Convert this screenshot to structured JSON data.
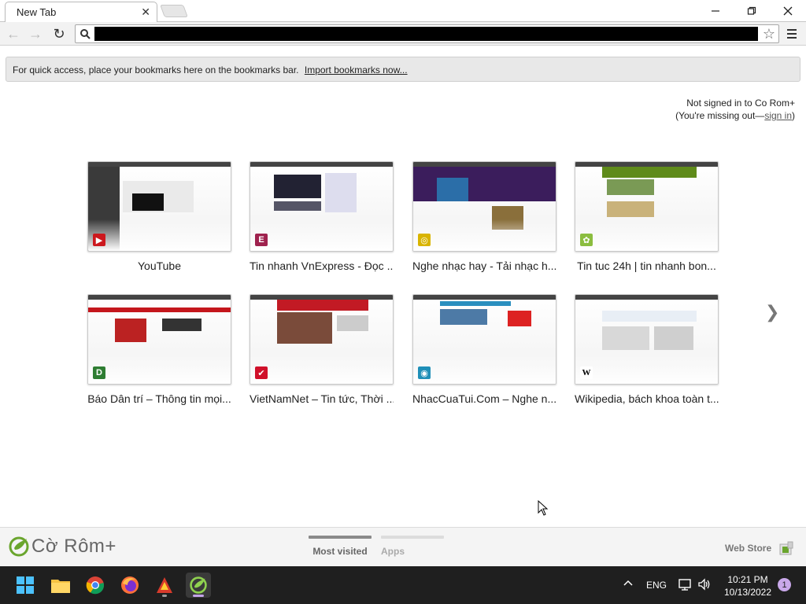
{
  "browser": {
    "tab_title": "New Tab",
    "tab_close": "✕",
    "window_min": "—",
    "window_max": "❐",
    "window_close": "✕",
    "nav_back": "←",
    "nav_forward": "→",
    "nav_reload": "↻",
    "star": "☆"
  },
  "bookmarks_bar": {
    "message": "For quick access, place your bookmarks here on the bookmarks bar.",
    "import_link": "Import bookmarks now..."
  },
  "signin": {
    "line1": "Not signed in to Co Rom+",
    "line2_prefix": "(You're missing out—",
    "link": "sign in",
    "line2_suffix": ")"
  },
  "most_visited": [
    {
      "label": "YouTube",
      "favicon": "youtube-icon",
      "favicon_color": "#cc181e",
      "favicon_glyph": "▶"
    },
    {
      "label": "Tin nhanh VnExpress - Đọc ...",
      "favicon": "vnexpress-icon",
      "favicon_color": "#9f224e",
      "favicon_glyph": "E"
    },
    {
      "label": "Nghe nhạc hay - Tải nhạc h...",
      "favicon": "music-disc-icon",
      "favicon_color": "#d9b400",
      "favicon_glyph": "◎"
    },
    {
      "label": "Tin tuc 24h | tin nhanh bon...",
      "favicon": "24h-icon",
      "favicon_color": "#8bbd3f",
      "favicon_glyph": "✿"
    },
    {
      "label": "Báo Dân trí – Thông tin mọi...",
      "favicon": "dantri-icon",
      "favicon_color": "#2e7d32",
      "favicon_glyph": "D"
    },
    {
      "label": "VietNamNet – Tin tức, Thời ...",
      "favicon": "vietnamnet-icon",
      "favicon_color": "#d0102a",
      "favicon_glyph": "✔"
    },
    {
      "label": "NhacCuaTui.Com – Nghe n...",
      "favicon": "nhaccuatui-icon",
      "favicon_color": "#1f8fb8",
      "favicon_glyph": "◉"
    },
    {
      "label": "Wikipedia, bách khoa toàn t...",
      "favicon": "wikipedia-icon",
      "favicon_color": "#ffffff",
      "favicon_glyph": "W"
    }
  ],
  "next_page": "❯",
  "footer": {
    "brand": "Cờ Rôm+",
    "tab_most_visited": "Most visited",
    "tab_apps": "Apps",
    "web_store": "Web Store"
  },
  "taskbar": {
    "apps": [
      "windows-start-icon",
      "file-explorer-icon",
      "chrome-icon",
      "firefox-icon",
      "game-app-icon",
      "coccoc-browser-icon"
    ],
    "language": "ENG",
    "time": "10:21 PM",
    "date": "10/13/2022",
    "notification_count": "1"
  }
}
